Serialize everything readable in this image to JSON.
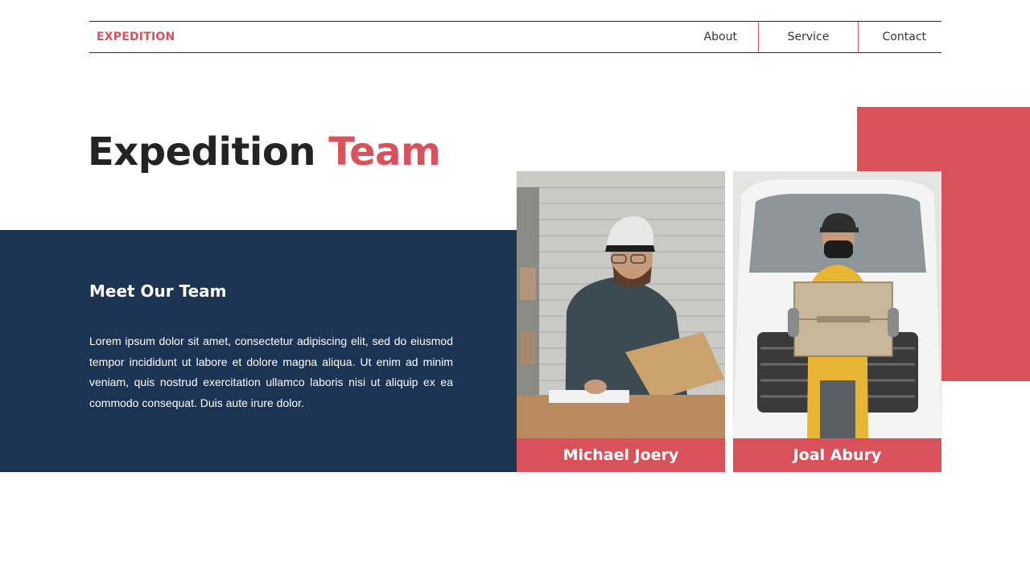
{
  "nav": {
    "brand": "EXPEDITION",
    "links": [
      {
        "label": "About"
      },
      {
        "label": "Service"
      },
      {
        "label": "Contact"
      }
    ]
  },
  "hero": {
    "title_main": "Expedition",
    "title_accent": "Team"
  },
  "panel": {
    "title": "Meet Our Team",
    "body": "Lorem ipsum dolor sit amet, consectetur adipiscing elit, sed do eiusmod tempor incididunt ut labore et dolore magna aliqua. Ut enim ad minim veniam, quis nostrud exercitation ullamco laboris nisi ut aliquip ex ea commodo consequat. Duis aute irure dolor."
  },
  "team": [
    {
      "name": "Michael Joery"
    },
    {
      "name": "Joal Abury"
    }
  ],
  "colors": {
    "accent": "#d9525b",
    "navy": "#1b3454",
    "text_dark": "#232323"
  }
}
